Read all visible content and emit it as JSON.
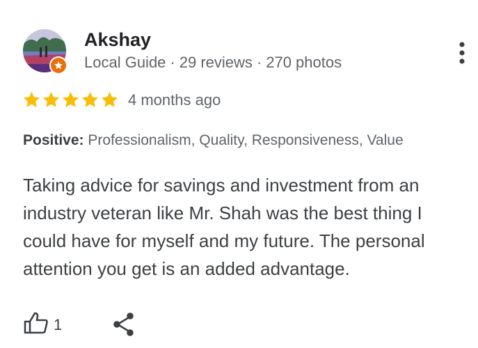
{
  "reviewer": {
    "name": "Akshay",
    "badge_icon": "local-guide-star-icon",
    "role": "Local Guide",
    "reviews": "29 reviews",
    "photos": "270 photos"
  },
  "review": {
    "rating": 5,
    "rating_max": 5,
    "date": "4 months ago",
    "positive_label": "Positive:",
    "positive_items": "Professionalism, Quality, Responsiveness, Value",
    "text": "Taking advice for savings and investment from an industry veteran like Mr. Shah was the best thing I could have for myself and my future. The personal attention you get is an added advantage."
  },
  "actions": {
    "like_icon": "thumbs-up-icon",
    "like_count": "1",
    "share_icon": "share-icon",
    "more_icon": "more-vertical-icon"
  },
  "colors": {
    "star": "#fbbc04",
    "badge": "#e8710a",
    "text": "#3c4043",
    "secondary": "#5f6368"
  }
}
